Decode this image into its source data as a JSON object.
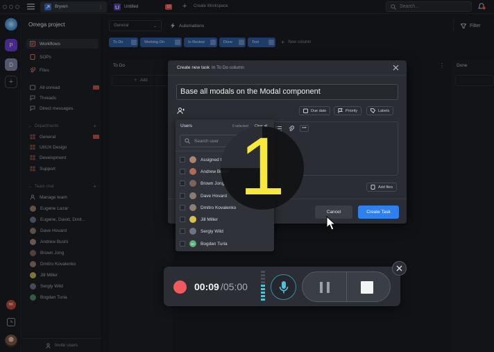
{
  "topbar": {
    "tabs": [
      {
        "label": "Bryxen"
      },
      {
        "label": "Untitled",
        "badge": "12"
      }
    ],
    "create_workspace": "Create Workspace",
    "search_placeholder": "Search..."
  },
  "rail": {
    "workspace_o": "O",
    "workspace_p": "P",
    "workspace_d": "D",
    "user_initials": "NK"
  },
  "sidebar": {
    "project": "Omega project",
    "nav": [
      {
        "label": "Workflows"
      },
      {
        "label": "SOPs"
      },
      {
        "label": "Files"
      }
    ],
    "inbox": [
      {
        "label": "All unread"
      },
      {
        "label": "Threads"
      },
      {
        "label": "Direct messages"
      }
    ],
    "departments_title": "Departments",
    "departments": [
      {
        "label": "General"
      },
      {
        "label": "UI/UX Design"
      },
      {
        "label": "Development"
      },
      {
        "label": "Support"
      }
    ],
    "team_chat_title": "Team chat",
    "team_chat": [
      {
        "label": "Manage team"
      },
      {
        "label": "Eugene Lazar"
      },
      {
        "label": "Eugene, David, Dmit..."
      },
      {
        "label": "Dave Hovard"
      },
      {
        "label": "Andrew Bushi"
      },
      {
        "label": "Brown Jong"
      },
      {
        "label": "Dmitro Kovalenko"
      },
      {
        "label": "Jill Miller"
      },
      {
        "label": "Sergiy Wild"
      },
      {
        "label": "Bogdan Turia"
      }
    ],
    "invite": "Invite users"
  },
  "main": {
    "general_select": "General",
    "automations": "Automations",
    "filter": "Filter",
    "columns": [
      {
        "label": "To Do"
      },
      {
        "label": "Working On"
      },
      {
        "label": "In Review"
      },
      {
        "label": "Done"
      },
      {
        "label": "Test"
      }
    ],
    "new_column": "New column",
    "todo_header": "To Do",
    "done_header": "Done",
    "add_label": "Add"
  },
  "modal": {
    "header_tab": "Create new task",
    "header_context": "In To Do column",
    "title_value": "Base all modals on the Modal component",
    "due_date": "Due date",
    "priority": "Priority",
    "labels": "Labels",
    "add_files": "Add files",
    "cancel": "Cancel",
    "create": "Create Task"
  },
  "users_dropdown": {
    "title": "Users",
    "selected": "0 selected",
    "clear_all": "Clear all",
    "search_placeholder": "Search user",
    "items": [
      {
        "label": "Assigned to me"
      },
      {
        "label": "Andrew Bushi"
      },
      {
        "label": "Brown Jong"
      },
      {
        "label": "Dave Hovard"
      },
      {
        "label": "Dmitro Kovalenko"
      },
      {
        "label": "Jill Miller"
      },
      {
        "label": "Sergiy Wild"
      },
      {
        "label": "Bogdan Turia"
      }
    ],
    "bogdan_initials": "BT"
  },
  "countdown": {
    "number": "1"
  },
  "recorder": {
    "elapsed": "00:09",
    "total": "/05:00",
    "level": 0.55
  },
  "colors": {
    "accent": "#2f80ed",
    "record": "#f05a5a",
    "mic": "#4fc3d8",
    "countdown": "#f7e93a"
  }
}
